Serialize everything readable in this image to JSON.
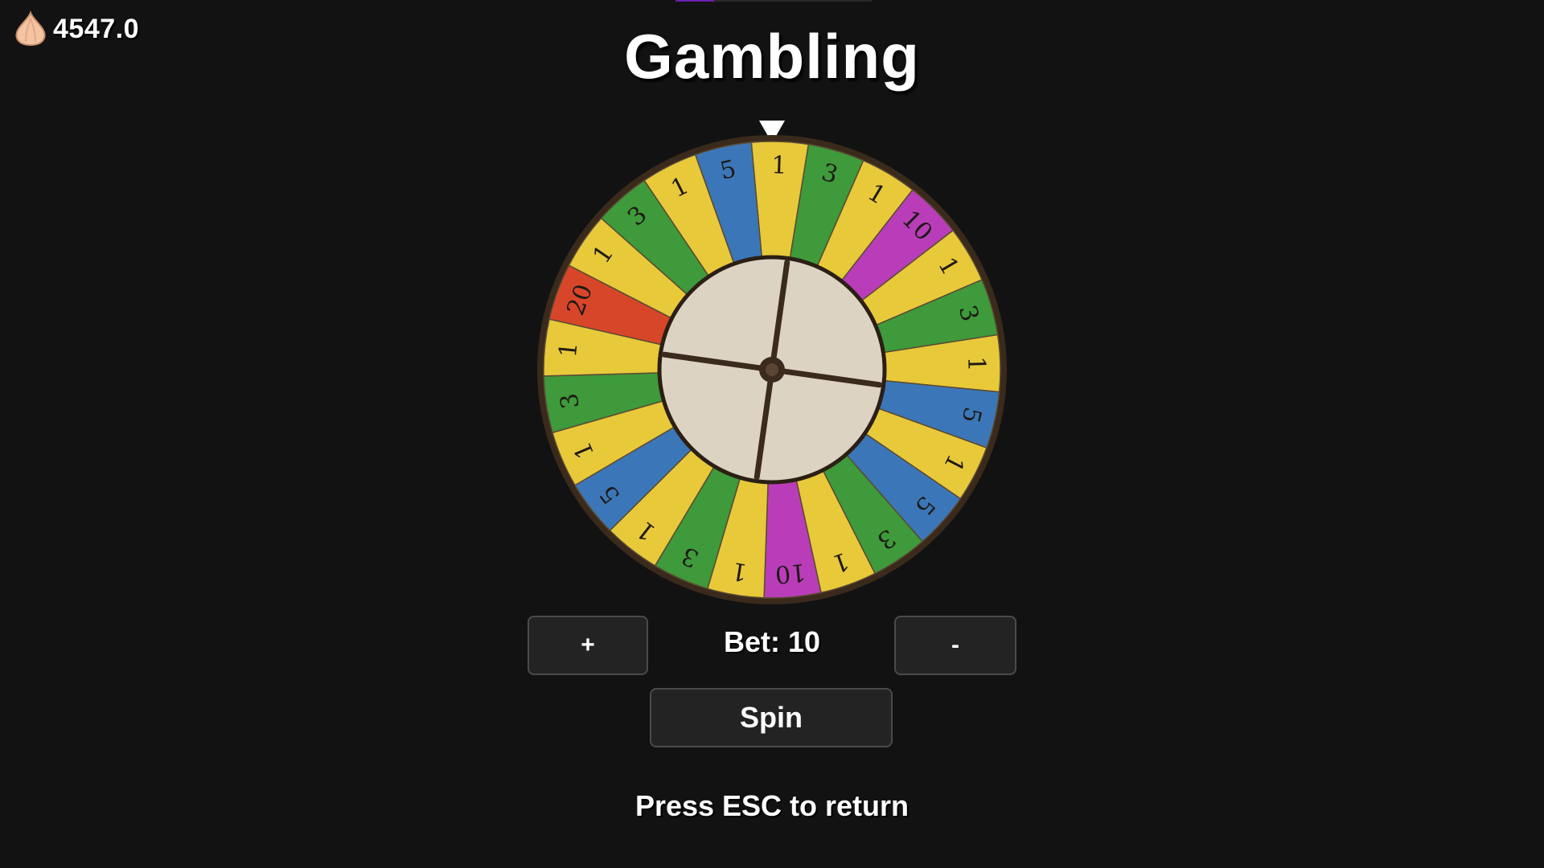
{
  "hud": {
    "currency_icon": "onion-coin-icon",
    "currency_value": "4547.0"
  },
  "title": "Gambling",
  "wheel": {
    "pointer_icon": "pointer-triangle-icon",
    "segments": [
      {
        "label": "1",
        "color": "#e8c93a"
      },
      {
        "label": "3",
        "color": "#3e9a3a"
      },
      {
        "label": "1",
        "color": "#e8c93a"
      },
      {
        "label": "10",
        "color": "#b93db8"
      },
      {
        "label": "1",
        "color": "#e8c93a"
      },
      {
        "label": "3",
        "color": "#3e9a3a"
      },
      {
        "label": "1",
        "color": "#e8c93a"
      },
      {
        "label": "5",
        "color": "#3b77b8"
      },
      {
        "label": "1",
        "color": "#e8c93a"
      },
      {
        "label": "5",
        "color": "#3b77b8"
      },
      {
        "label": "3",
        "color": "#3e9a3a"
      },
      {
        "label": "1",
        "color": "#e8c93a"
      },
      {
        "label": "10",
        "color": "#b93db8"
      },
      {
        "label": "1",
        "color": "#e8c93a"
      },
      {
        "label": "3",
        "color": "#3e9a3a"
      },
      {
        "label": "1",
        "color": "#e8c93a"
      },
      {
        "label": "5",
        "color": "#3b77b8"
      },
      {
        "label": "1",
        "color": "#e8c93a"
      },
      {
        "label": "3",
        "color": "#3e9a3a"
      },
      {
        "label": "1",
        "color": "#e8c93a"
      },
      {
        "label": "20",
        "color": "#d8462a"
      },
      {
        "label": "1",
        "color": "#e8c93a"
      },
      {
        "label": "3",
        "color": "#3e9a3a"
      },
      {
        "label": "1",
        "color": "#e8c93a"
      },
      {
        "label": "5",
        "color": "#3b77b8"
      }
    ]
  },
  "controls": {
    "plus_label": "+",
    "minus_label": "-",
    "bet_text": "Bet: 10",
    "spin_label": "Spin"
  },
  "hint": "Press ESC to return"
}
